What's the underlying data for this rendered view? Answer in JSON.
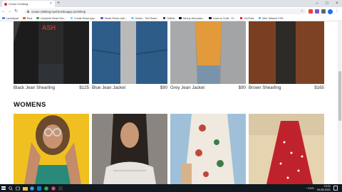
{
  "browser": {
    "tab_title": "Crown Clothing",
    "tab_close": "×",
    "new_tab": "+",
    "url": "crown-clothing-cwd.herokuapp.com/shop",
    "win_minimize": "–",
    "win_maximize": "□",
    "win_close": "×",
    "bookmarks": [
      {
        "label": "Launchpad",
        "color": "#4285f4"
      },
      {
        "label": "Rest",
        "color": "#e74c3c"
      },
      {
        "label": "Complete React Dev...",
        "color": "#34a853"
      },
      {
        "label": "Create React App...",
        "color": "#61dafb"
      },
      {
        "label": "React Redux web...",
        "color": "#764abc"
      },
      {
        "label": "Hooks - The React...",
        "color": "#61dafb"
      },
      {
        "label": "GitHub",
        "color": "#333333"
      },
      {
        "label": "Next.js Discussio...",
        "color": "#000000"
      },
      {
        "label": "Learn to Code - Fr...",
        "color": "#0a0a23"
      },
      {
        "label": "YouTube",
        "color": "#ff0000"
      },
      {
        "label": "Wes Tailwind CSS...",
        "color": "#38bdf8"
      }
    ]
  },
  "mens_products": [
    {
      "name": "Black Jean Shearling",
      "price": "$125"
    },
    {
      "name": "Blue Jean Jacket",
      "price": "$90"
    },
    {
      "name": "Grey Jean Jacket",
      "price": "$90"
    },
    {
      "name": "Brown Shearling",
      "price": "$165"
    }
  ],
  "womens_section_title": "WOMENS",
  "taskbar": {
    "time": "13:21",
    "date": "04.06.2021",
    "tray": "^  ENG"
  },
  "colors": {
    "taskbar_bg": "#101820",
    "tabbar_bg": "#dee1e6"
  }
}
